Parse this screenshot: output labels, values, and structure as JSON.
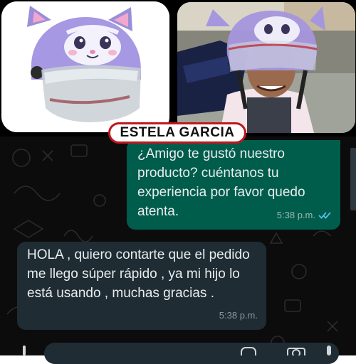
{
  "header": {
    "contact_name": "ESTELA GARCIA"
  },
  "photos": {
    "left_icon": "purple-cat-helmet-product-photo",
    "right_icon": "child-wearing-cat-helmet-photo"
  },
  "messages": [
    {
      "direction": "outgoing",
      "text": "¿Amigo te gustó nuestro producto? cuéntanos tu experiencia por favor quedo atenta.",
      "time": "5:38 p.m.",
      "status": "read-double-check",
      "status_color": "#53bdeb"
    },
    {
      "direction": "incoming",
      "text": "HOLA , quiero contarte que el pedido me llego súper rápido , ya mi hijo lo está usando , muchas gracias .",
      "time": "5:38 p.m."
    }
  ],
  "composer": {
    "icons": [
      "mic-icon",
      "sticker-icon",
      "camera-icon"
    ]
  },
  "colors": {
    "chat_background": "#0c0c0c",
    "outgoing_bubble": "#005c4b",
    "incoming_bubble": "#1f2c33",
    "badge_border": "#c0161d"
  }
}
